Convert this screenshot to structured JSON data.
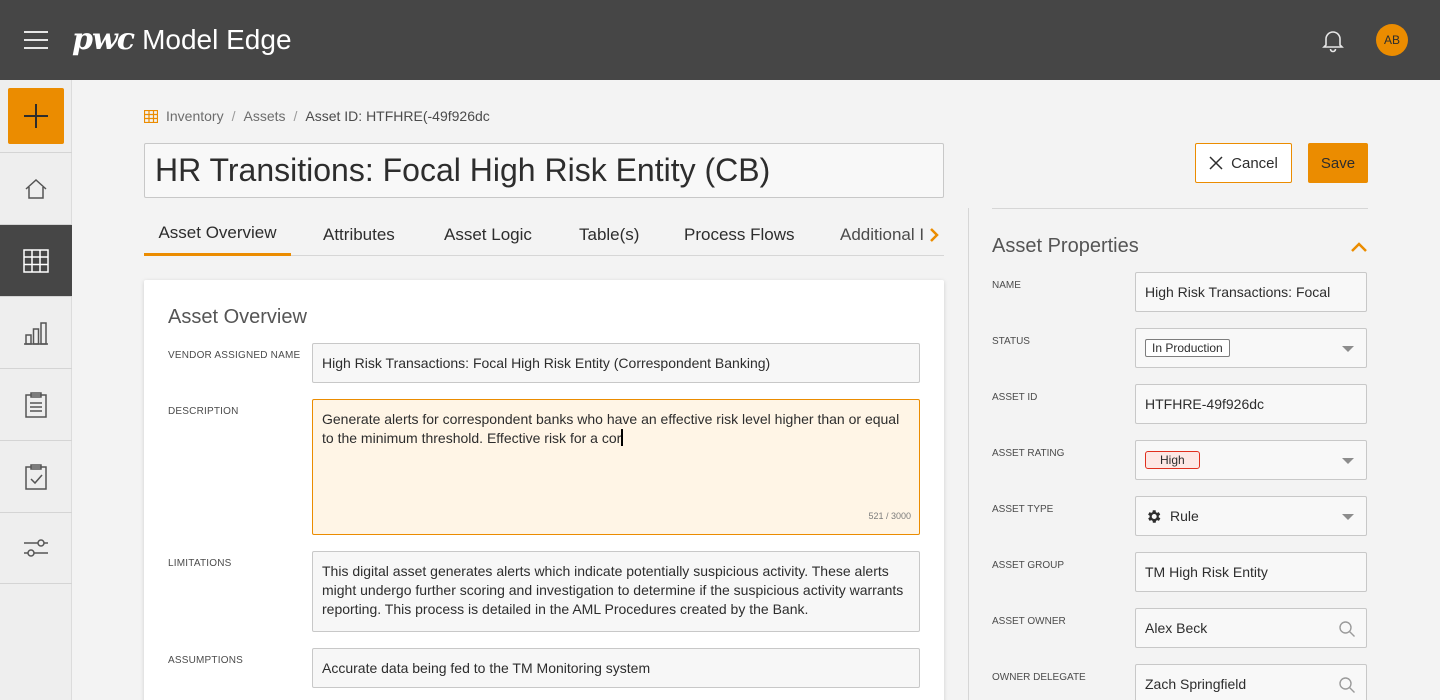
{
  "app": {
    "brand": "pwc",
    "name": "Model Edge",
    "user_initials": "AB",
    "accent": "#eb8c00"
  },
  "icons": {
    "menu": "hamburger-menu-icon",
    "notifications": "bell-icon",
    "add": "plus-icon",
    "nav": [
      "home-icon",
      "grid-icon",
      "bar-chart-icon",
      "clipboard-icon",
      "clipboard-check-icon",
      "sliders-icon"
    ],
    "breadcrumb": "grid-icon",
    "cancel": "close-icon",
    "tab_scroll": "chevron-right-icon",
    "collapse": "chevron-up-icon",
    "asset_type": "gear-icon",
    "lookup": "search-icon"
  },
  "breadcrumb": {
    "items": [
      "Inventory",
      "Assets"
    ],
    "current": "Asset ID: HTFHRE(-49f926dc"
  },
  "page": {
    "title": "HR Transitions: Focal High Risk Entity (CB)"
  },
  "actions": {
    "cancel": "Cancel",
    "save": "Save"
  },
  "tabs": [
    "Asset Overview",
    "Attributes",
    "Asset Logic",
    "Table(s)",
    "Process Flows",
    "Additional I"
  ],
  "overview": {
    "title": "Asset Overview",
    "fields": {
      "vendor_name": {
        "label": "Vendor Assigned Name",
        "value": "High Risk Transactions: Focal High Risk Entity (Correspondent Banking)"
      },
      "description": {
        "label": "Description",
        "value": "Generate alerts for correspondent banks who have an effective risk level higher than or equal to the minimum threshold. Effective risk for a cor",
        "count": "521 / 3000"
      },
      "limitations": {
        "label": "Limitations",
        "value": "This digital asset generates alerts which indicate potentially suspicious activity. These alerts might undergo further scoring and investigation to determine if the suspicious activity warrants reporting. This process is detailed in the AML Procedures created by the Bank."
      },
      "assumptions": {
        "label": "Assumptions",
        "value": "Accurate data being fed to the TM Monitoring system"
      }
    }
  },
  "properties": {
    "title": "Asset Properties",
    "name": {
      "label": "Name",
      "value": "High Risk Transactions: Focal"
    },
    "status": {
      "label": "Status",
      "value": "In Production"
    },
    "asset_id": {
      "label": "Asset ID",
      "value": "HTFHRE-49f926dc"
    },
    "rating": {
      "label": "Asset Rating",
      "value": "High",
      "color": "#e0301e"
    },
    "type": {
      "label": "Asset Type",
      "value": "Rule"
    },
    "group": {
      "label": "Asset Group",
      "value": "TM High Risk Entity"
    },
    "owner": {
      "label": "Asset Owner",
      "value": "Alex Beck"
    },
    "delegate": {
      "label": "Owner Delegate",
      "value": "Zach Springfield"
    }
  }
}
